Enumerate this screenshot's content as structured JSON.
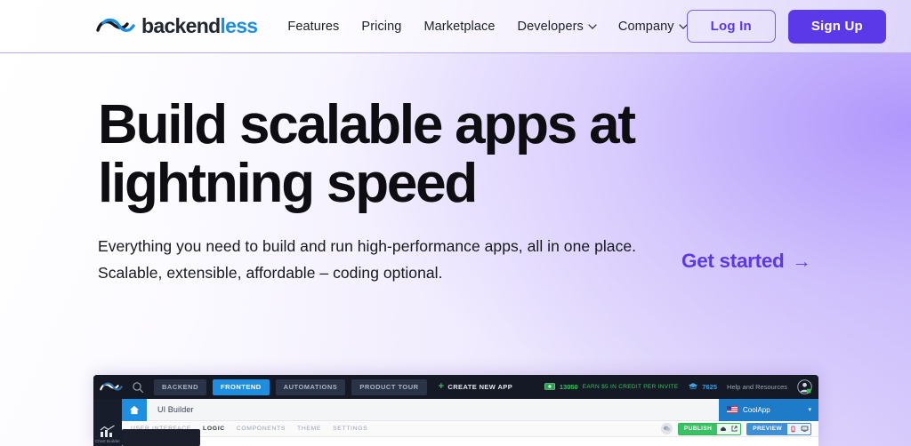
{
  "brand": {
    "name_dark": "backend",
    "name_accent": "less",
    "logo_icon": "backendless-ribbon-icon",
    "accent_color": "#1e8fe0",
    "primary_color": "#5b39e8"
  },
  "header": {
    "nav": [
      {
        "label": "Features",
        "has_dropdown": false
      },
      {
        "label": "Pricing",
        "has_dropdown": false
      },
      {
        "label": "Marketplace",
        "has_dropdown": false
      },
      {
        "label": "Developers",
        "has_dropdown": true
      },
      {
        "label": "Company",
        "has_dropdown": true
      }
    ],
    "login_label": "Log In",
    "signup_label": "Sign Up"
  },
  "hero": {
    "title_line1": "Build scalable apps at",
    "title_line2": "lightning speed",
    "subtitle": "Everything you need to build and run high-performance apps, all in one place. Scalable, extensible, affordable – coding optional.",
    "cta_label": "Get started",
    "cta_arrow": "→"
  },
  "app_preview": {
    "topbar": {
      "search_icon": "search-icon",
      "tabs": [
        {
          "label": "BACKEND",
          "active": false
        },
        {
          "label": "FRONTEND",
          "active": true
        },
        {
          "label": "AUTOMATIONS",
          "active": false
        },
        {
          "label": "PRODUCT TOUR",
          "active": false
        }
      ],
      "create_new_app": "CREATE NEW APP",
      "credit_amount": "13050",
      "credit_text": "EARN $5 IN CREDIT PER INVITE",
      "points": "7625",
      "help_label": "Help and Resources",
      "avatar_icon": "user-avatar-icon"
    },
    "rail": {
      "label": "Chart Builder",
      "icon": "bar-chart-icon"
    },
    "breadcrumb": {
      "home_icon": "home-icon",
      "title": "UI Builder"
    },
    "app_selector": {
      "name": "CoolApp",
      "flag": "us-flag-icon",
      "caret": "▾"
    },
    "sub_tabs": [
      {
        "label": "USER INTERFACE",
        "active": false
      },
      {
        "label": "LOGIC",
        "active": true
      },
      {
        "label": "COMPONENTS",
        "active": false
      },
      {
        "label": "THEME",
        "active": false
      },
      {
        "label": "SETTINGS",
        "active": false
      }
    ],
    "actions": {
      "chat_icon": "chat-bubble-icon",
      "publish_label": "PUBLISH",
      "publish_icons": [
        "cloud-icon",
        "external-link-icon"
      ],
      "preview_label": "PREVIEW",
      "preview_icons": [
        "mobile-icon",
        "desktop-icon"
      ]
    }
  }
}
